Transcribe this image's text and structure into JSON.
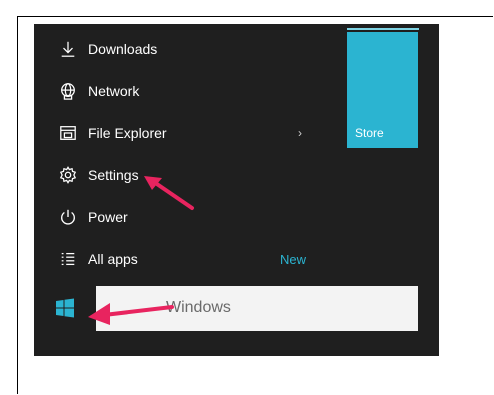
{
  "menu": {
    "items": [
      {
        "label": "Downloads",
        "icon": "download-icon"
      },
      {
        "label": "Network",
        "icon": "network-icon"
      },
      {
        "label": "File Explorer",
        "icon": "file-explorer-icon",
        "chevron": "›"
      },
      {
        "label": "Settings",
        "icon": "gear-icon"
      },
      {
        "label": "Power",
        "icon": "power-icon"
      },
      {
        "label": "All apps",
        "icon": "all-apps-icon",
        "badge": "New"
      }
    ]
  },
  "tiles": {
    "store_label": "Store"
  },
  "search": {
    "placeholder": "Windows"
  },
  "colors": {
    "accent": "#2bb4d1",
    "arrow": "#e8245f",
    "menu_bg": "#1f1f1f"
  }
}
